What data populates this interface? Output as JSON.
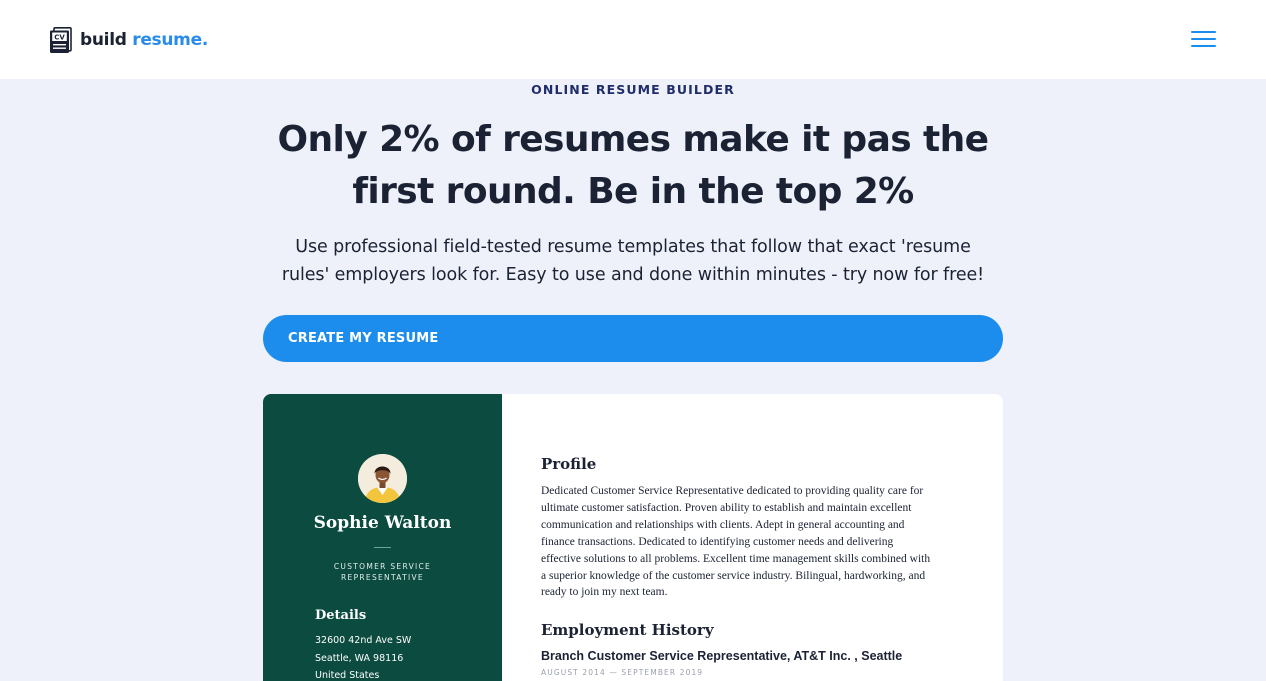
{
  "header": {
    "logo": {
      "icon": "cv-document-icon",
      "icon_text": "CV",
      "word1": "build",
      "word2": "resume.",
      "accent_color": "#2a8ce8"
    },
    "menu_icon": "hamburger-menu-icon"
  },
  "hero": {
    "eyebrow": "ONLINE RESUME BUILDER",
    "headline_line1": "Only 2% of resumes make it pas the",
    "headline_line2": "first round. Be in the top 2%",
    "subtext_line1": "Use professional field-tested resume templates that follow that exact 'resume",
    "subtext_line2": "rules' employers look for. Easy to use and done within minutes - try now for free!",
    "cta_label": "CREATE MY RESUME",
    "cta_color": "#1d8ded"
  },
  "resume_preview": {
    "sidebar_color": "#0b4b40",
    "name": "Sophie Walton",
    "role_line1": "CUSTOMER SERVICE",
    "role_line2": "REPRESENTATIVE",
    "details_title": "Details",
    "details": [
      "32600 42nd Ave SW",
      "Seattle, WA 98116",
      "United States"
    ],
    "profile_title": "Profile",
    "profile_lines": [
      "Dedicated Customer Service Representative dedicated to providing quality care for",
      "ultimate customer satisfaction. Proven ability to establish and maintain excellent",
      "communication and relationships with clients. Adept in general accounting and",
      "finance transactions. Dedicated to identifying customer needs and delivering",
      "effective solutions to all problems. Excellent time management skills combined with",
      "a superior knowledge of the customer service industry. Bilingual, hardworking, and",
      "ready to join my next team."
    ],
    "employment_title": "Employment History",
    "job_title": "Branch Customer Service Representative, AT&T Inc. , Seattle",
    "job_dates": "AUGUST 2014 — SEPTEMBER 2019"
  }
}
